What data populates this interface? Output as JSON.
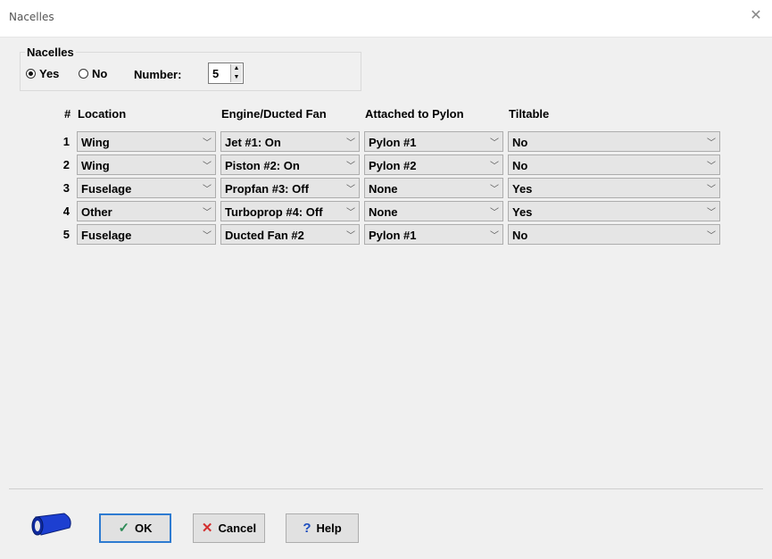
{
  "window": {
    "title": "Nacelles",
    "close_icon": "close-icon"
  },
  "nacelles_group": {
    "legend": "Nacelles",
    "radio_yes": {
      "label": "Yes",
      "checked": true
    },
    "radio_no": {
      "label": "No",
      "checked": false
    },
    "number_label": "Number:",
    "number_value": "5"
  },
  "table": {
    "headers": {
      "num": "#",
      "location": "Location",
      "engine": "Engine/Ducted Fan",
      "pylon": "Attached to Pylon",
      "tiltable": "Tiltable"
    },
    "rows": [
      {
        "num": "1",
        "location": "Wing",
        "engine": "Jet #1: On",
        "pylon": "Pylon #1",
        "tiltable": "No"
      },
      {
        "num": "2",
        "location": "Wing",
        "engine": "Piston #2: On",
        "pylon": "Pylon #2",
        "tiltable": "No"
      },
      {
        "num": "3",
        "location": "Fuselage",
        "engine": "Propfan #3: Off",
        "pylon": "None",
        "tiltable": "Yes"
      },
      {
        "num": "4",
        "location": "Other",
        "engine": "Turboprop #4: Off",
        "pylon": "None",
        "tiltable": "Yes"
      },
      {
        "num": "5",
        "location": "Fuselage",
        "engine": "Ducted Fan #2",
        "pylon": "Pylon #1",
        "tiltable": "No"
      }
    ]
  },
  "buttons": {
    "ok": "OK",
    "cancel": "Cancel",
    "help": "Help"
  },
  "colors": {
    "ok_check": "#2e8b57",
    "cancel_x": "#d32f2f",
    "help_q": "#1f4fbf",
    "nacelle_icon": "#1d3fd1",
    "default_border": "#2e7bd1"
  }
}
